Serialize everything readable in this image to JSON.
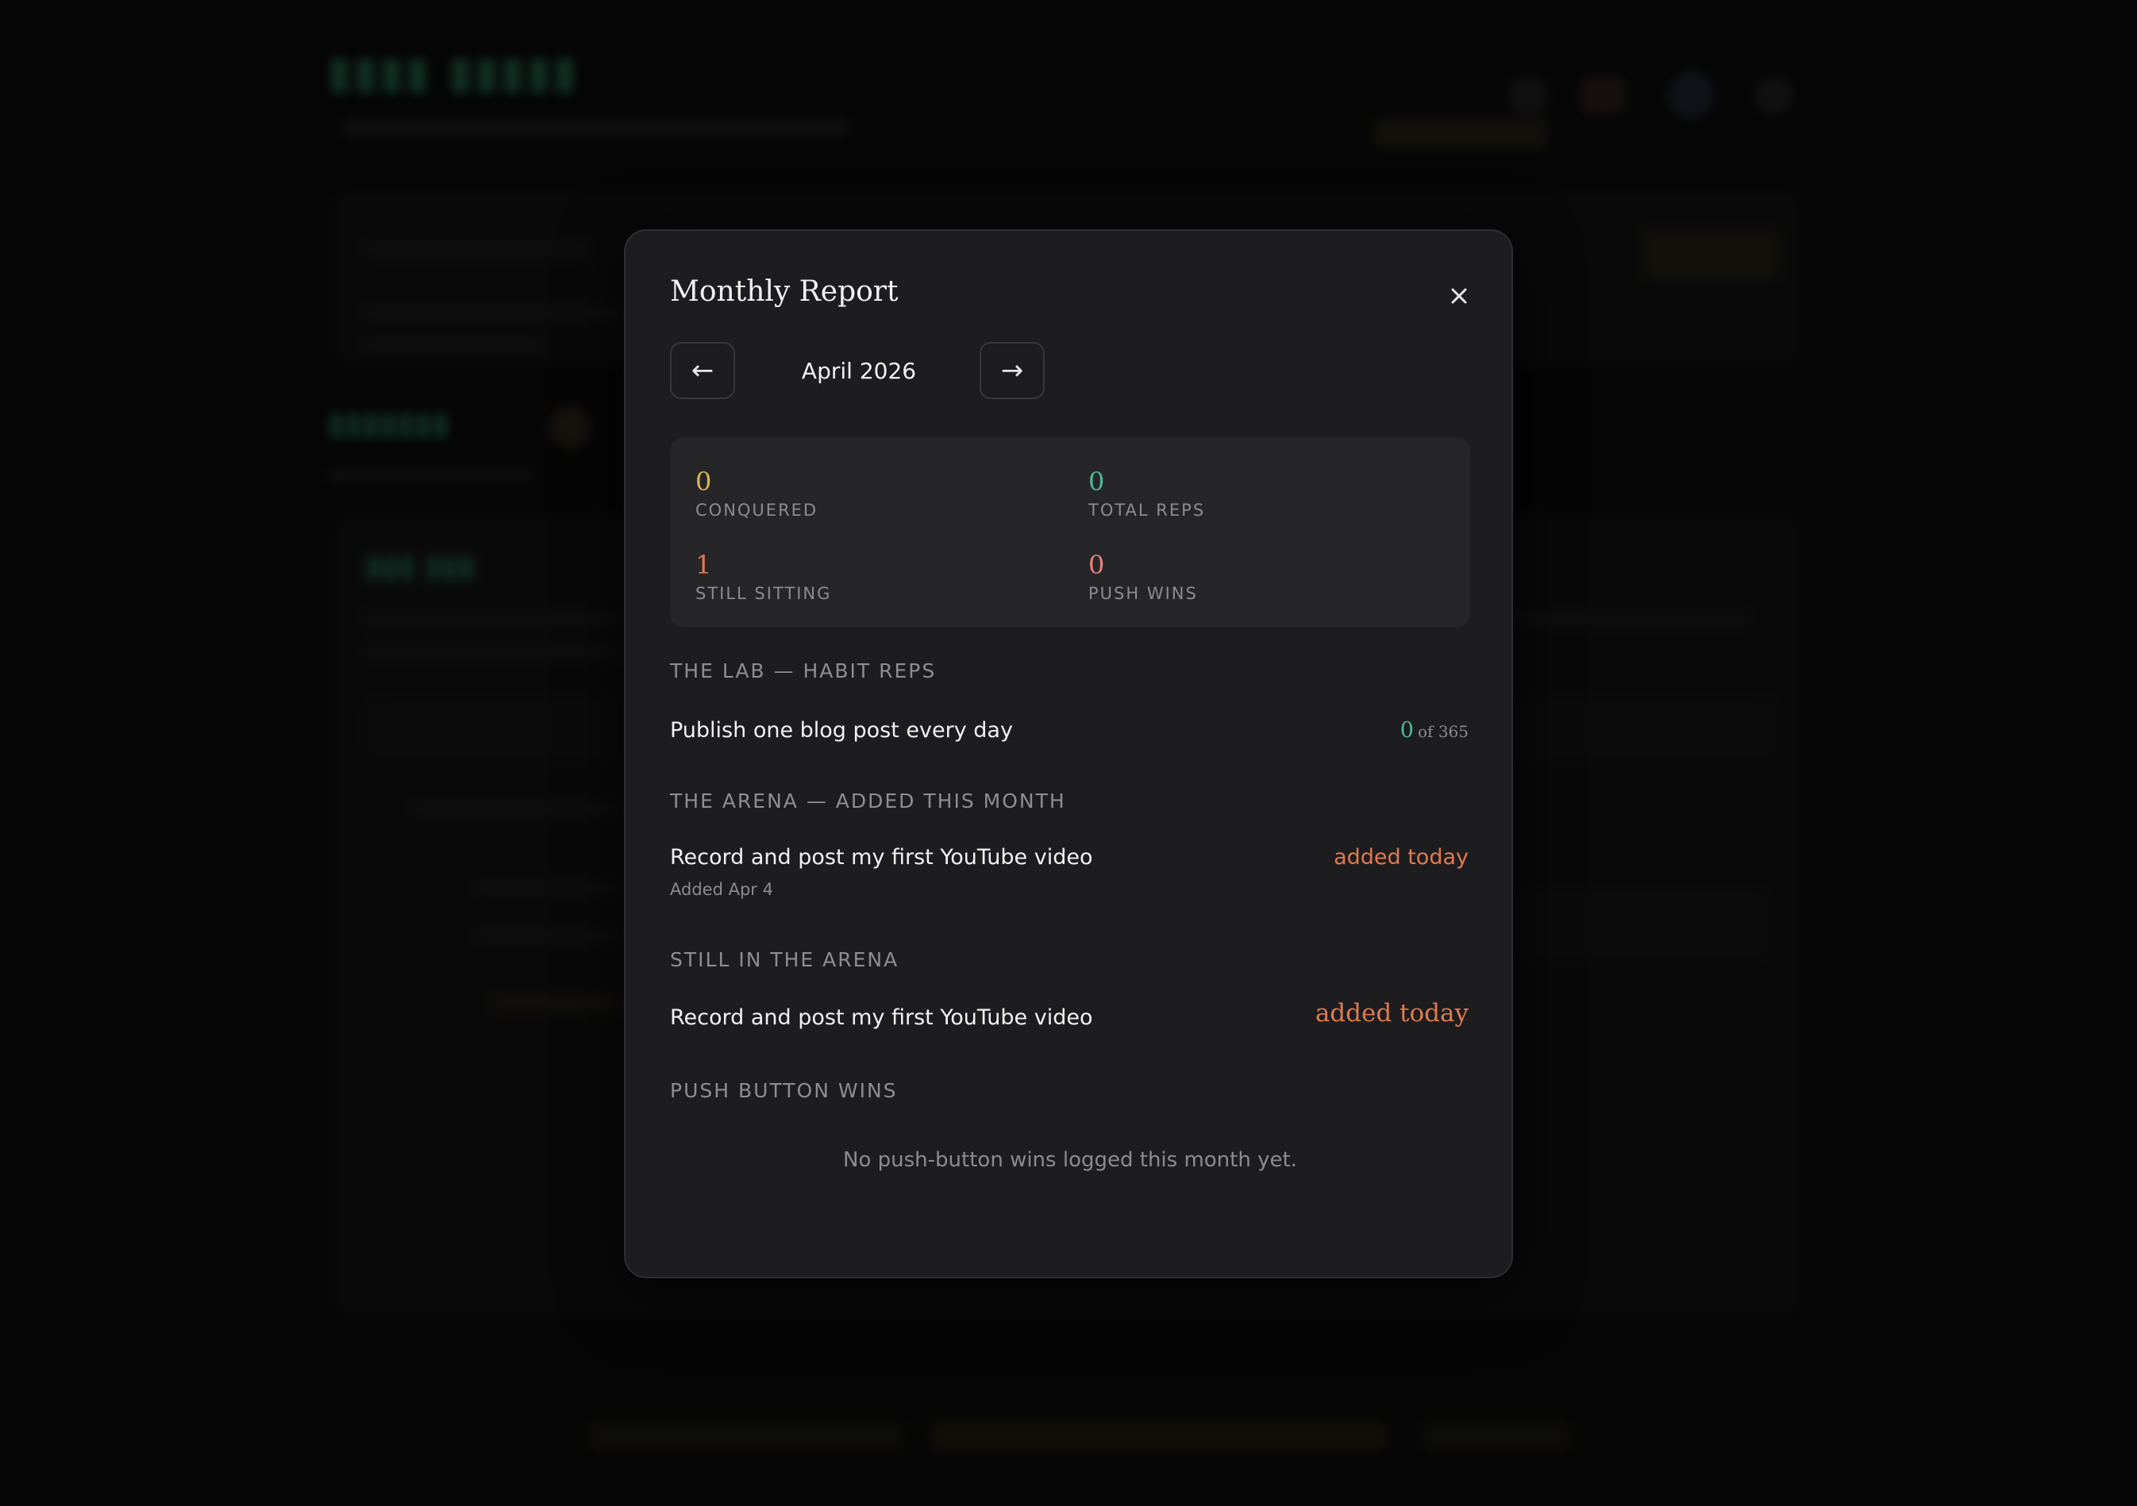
{
  "modal": {
    "title": "Monthly Report",
    "close_symbol": "×",
    "month": "April 2026",
    "prev_symbol": "←",
    "next_symbol": "→"
  },
  "stats": [
    {
      "value": "0",
      "label": "CONQUERED",
      "color": "#d8b650"
    },
    {
      "value": "0",
      "label": "TOTAL REPS",
      "color": "#4fb896"
    },
    {
      "value": "1",
      "label": "STILL SITTING",
      "color": "#e07a4f"
    },
    {
      "value": "0",
      "label": "PUSH WINS",
      "color": "#e8807a"
    }
  ],
  "sections": {
    "lab": {
      "heading": "THE LAB — HABIT REPS",
      "item": "Publish one blog post every day",
      "count": "0",
      "of_total": "of 365"
    },
    "arena_added": {
      "heading": "THE ARENA — ADDED THIS MONTH",
      "item": "Record and post my first YouTube video",
      "sub": "Added Apr 4",
      "status": "added today"
    },
    "still_arena": {
      "heading": "STILL IN THE ARENA",
      "item": "Record and post my first YouTube video",
      "status": "added today"
    },
    "push_wins": {
      "heading": "PUSH BUTTON WINS",
      "empty": "No push-button wins logged this month yet."
    }
  },
  "colors": {
    "accent_orange": "#e07a4f",
    "accent_green": "#4fb896"
  }
}
